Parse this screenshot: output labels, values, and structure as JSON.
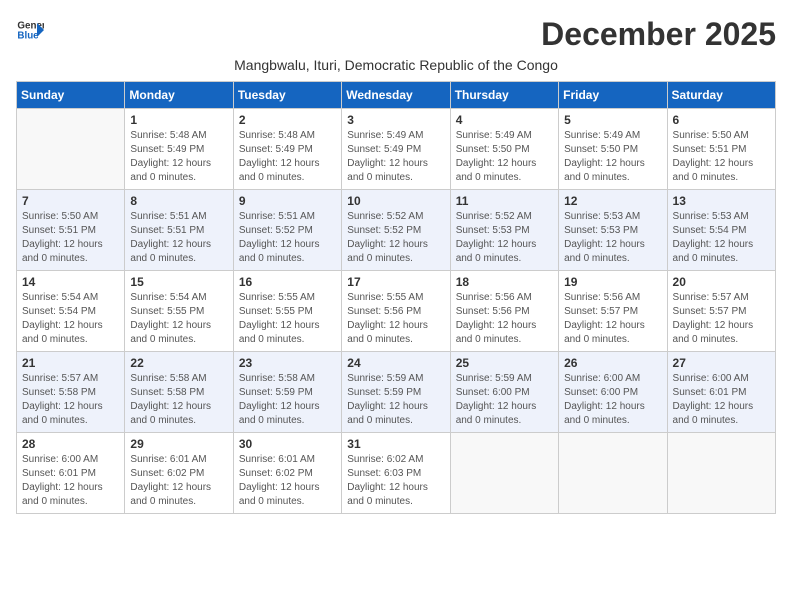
{
  "logo": {
    "line1": "General",
    "line2": "Blue"
  },
  "title": "December 2025",
  "subtitle": "Mangbwalu, Ituri, Democratic Republic of the Congo",
  "days_of_week": [
    "Sunday",
    "Monday",
    "Tuesday",
    "Wednesday",
    "Thursday",
    "Friday",
    "Saturday"
  ],
  "weeks": [
    [
      {
        "day": "",
        "sunrise": "",
        "sunset": "",
        "daylight": ""
      },
      {
        "day": "1",
        "sunrise": "Sunrise: 5:48 AM",
        "sunset": "Sunset: 5:49 PM",
        "daylight": "Daylight: 12 hours and 0 minutes."
      },
      {
        "day": "2",
        "sunrise": "Sunrise: 5:48 AM",
        "sunset": "Sunset: 5:49 PM",
        "daylight": "Daylight: 12 hours and 0 minutes."
      },
      {
        "day": "3",
        "sunrise": "Sunrise: 5:49 AM",
        "sunset": "Sunset: 5:49 PM",
        "daylight": "Daylight: 12 hours and 0 minutes."
      },
      {
        "day": "4",
        "sunrise": "Sunrise: 5:49 AM",
        "sunset": "Sunset: 5:50 PM",
        "daylight": "Daylight: 12 hours and 0 minutes."
      },
      {
        "day": "5",
        "sunrise": "Sunrise: 5:49 AM",
        "sunset": "Sunset: 5:50 PM",
        "daylight": "Daylight: 12 hours and 0 minutes."
      },
      {
        "day": "6",
        "sunrise": "Sunrise: 5:50 AM",
        "sunset": "Sunset: 5:51 PM",
        "daylight": "Daylight: 12 hours and 0 minutes."
      }
    ],
    [
      {
        "day": "7",
        "sunrise": "Sunrise: 5:50 AM",
        "sunset": "Sunset: 5:51 PM",
        "daylight": "Daylight: 12 hours and 0 minutes."
      },
      {
        "day": "8",
        "sunrise": "Sunrise: 5:51 AM",
        "sunset": "Sunset: 5:51 PM",
        "daylight": "Daylight: 12 hours and 0 minutes."
      },
      {
        "day": "9",
        "sunrise": "Sunrise: 5:51 AM",
        "sunset": "Sunset: 5:52 PM",
        "daylight": "Daylight: 12 hours and 0 minutes."
      },
      {
        "day": "10",
        "sunrise": "Sunrise: 5:52 AM",
        "sunset": "Sunset: 5:52 PM",
        "daylight": "Daylight: 12 hours and 0 minutes."
      },
      {
        "day": "11",
        "sunrise": "Sunrise: 5:52 AM",
        "sunset": "Sunset: 5:53 PM",
        "daylight": "Daylight: 12 hours and 0 minutes."
      },
      {
        "day": "12",
        "sunrise": "Sunrise: 5:53 AM",
        "sunset": "Sunset: 5:53 PM",
        "daylight": "Daylight: 12 hours and 0 minutes."
      },
      {
        "day": "13",
        "sunrise": "Sunrise: 5:53 AM",
        "sunset": "Sunset: 5:54 PM",
        "daylight": "Daylight: 12 hours and 0 minutes."
      }
    ],
    [
      {
        "day": "14",
        "sunrise": "Sunrise: 5:54 AM",
        "sunset": "Sunset: 5:54 PM",
        "daylight": "Daylight: 12 hours and 0 minutes."
      },
      {
        "day": "15",
        "sunrise": "Sunrise: 5:54 AM",
        "sunset": "Sunset: 5:55 PM",
        "daylight": "Daylight: 12 hours and 0 minutes."
      },
      {
        "day": "16",
        "sunrise": "Sunrise: 5:55 AM",
        "sunset": "Sunset: 5:55 PM",
        "daylight": "Daylight: 12 hours and 0 minutes."
      },
      {
        "day": "17",
        "sunrise": "Sunrise: 5:55 AM",
        "sunset": "Sunset: 5:56 PM",
        "daylight": "Daylight: 12 hours and 0 minutes."
      },
      {
        "day": "18",
        "sunrise": "Sunrise: 5:56 AM",
        "sunset": "Sunset: 5:56 PM",
        "daylight": "Daylight: 12 hours and 0 minutes."
      },
      {
        "day": "19",
        "sunrise": "Sunrise: 5:56 AM",
        "sunset": "Sunset: 5:57 PM",
        "daylight": "Daylight: 12 hours and 0 minutes."
      },
      {
        "day": "20",
        "sunrise": "Sunrise: 5:57 AM",
        "sunset": "Sunset: 5:57 PM",
        "daylight": "Daylight: 12 hours and 0 minutes."
      }
    ],
    [
      {
        "day": "21",
        "sunrise": "Sunrise: 5:57 AM",
        "sunset": "Sunset: 5:58 PM",
        "daylight": "Daylight: 12 hours and 0 minutes."
      },
      {
        "day": "22",
        "sunrise": "Sunrise: 5:58 AM",
        "sunset": "Sunset: 5:58 PM",
        "daylight": "Daylight: 12 hours and 0 minutes."
      },
      {
        "day": "23",
        "sunrise": "Sunrise: 5:58 AM",
        "sunset": "Sunset: 5:59 PM",
        "daylight": "Daylight: 12 hours and 0 minutes."
      },
      {
        "day": "24",
        "sunrise": "Sunrise: 5:59 AM",
        "sunset": "Sunset: 5:59 PM",
        "daylight": "Daylight: 12 hours and 0 minutes."
      },
      {
        "day": "25",
        "sunrise": "Sunrise: 5:59 AM",
        "sunset": "Sunset: 6:00 PM",
        "daylight": "Daylight: 12 hours and 0 minutes."
      },
      {
        "day": "26",
        "sunrise": "Sunrise: 6:00 AM",
        "sunset": "Sunset: 6:00 PM",
        "daylight": "Daylight: 12 hours and 0 minutes."
      },
      {
        "day": "27",
        "sunrise": "Sunrise: 6:00 AM",
        "sunset": "Sunset: 6:01 PM",
        "daylight": "Daylight: 12 hours and 0 minutes."
      }
    ],
    [
      {
        "day": "28",
        "sunrise": "Sunrise: 6:00 AM",
        "sunset": "Sunset: 6:01 PM",
        "daylight": "Daylight: 12 hours and 0 minutes."
      },
      {
        "day": "29",
        "sunrise": "Sunrise: 6:01 AM",
        "sunset": "Sunset: 6:02 PM",
        "daylight": "Daylight: 12 hours and 0 minutes."
      },
      {
        "day": "30",
        "sunrise": "Sunrise: 6:01 AM",
        "sunset": "Sunset: 6:02 PM",
        "daylight": "Daylight: 12 hours and 0 minutes."
      },
      {
        "day": "31",
        "sunrise": "Sunrise: 6:02 AM",
        "sunset": "Sunset: 6:03 PM",
        "daylight": "Daylight: 12 hours and 0 minutes."
      },
      {
        "day": "",
        "sunrise": "",
        "sunset": "",
        "daylight": ""
      },
      {
        "day": "",
        "sunrise": "",
        "sunset": "",
        "daylight": ""
      },
      {
        "day": "",
        "sunrise": "",
        "sunset": "",
        "daylight": ""
      }
    ]
  ]
}
